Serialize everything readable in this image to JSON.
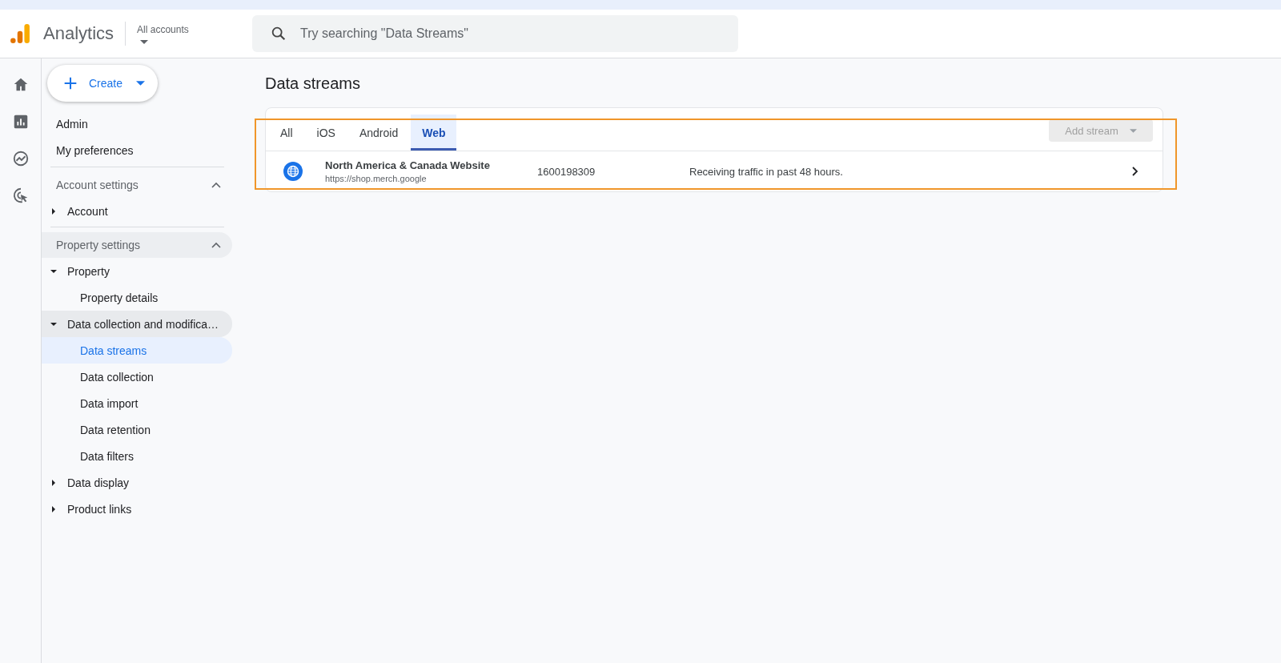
{
  "header": {
    "app_name": "Analytics",
    "account_label": "All accounts",
    "search": {
      "placeholder": "Try searching \"Data Streams\""
    }
  },
  "rail": [
    {
      "kind": "home",
      "selected": false
    },
    {
      "kind": "reports",
      "selected": false
    },
    {
      "kind": "explore",
      "selected": false
    },
    {
      "kind": "advertising",
      "selected": false
    }
  ],
  "create_button": "Create",
  "nav": [
    "Admin",
    "My preferences"
  ],
  "sections": [
    {
      "title": "Account settings",
      "expanded": true,
      "highlighted": false,
      "items": [
        {
          "label": "Account",
          "expanded": false,
          "highlighted": false
        }
      ]
    },
    {
      "title": "Property settings",
      "expanded": true,
      "highlighted": true,
      "items": [
        {
          "label": "Property",
          "expanded": true,
          "highlighted": false,
          "children": [
            {
              "label": "Property details",
              "selected": false
            }
          ]
        },
        {
          "label": "Data collection and modifica…",
          "expanded": true,
          "highlighted": true,
          "children": [
            {
              "label": "Data streams",
              "selected": true
            },
            {
              "label": "Data collection",
              "selected": false
            },
            {
              "label": "Data import",
              "selected": false
            },
            {
              "label": "Data retention",
              "selected": false
            },
            {
              "label": "Data filters",
              "selected": false
            }
          ]
        },
        {
          "label": "Data display",
          "expanded": false,
          "highlighted": false
        },
        {
          "label": "Product links",
          "expanded": false,
          "highlighted": false
        }
      ]
    }
  ],
  "page_title": "Data streams",
  "tabs": [
    {
      "label": "All",
      "selected": false
    },
    {
      "label": "iOS",
      "selected": false
    },
    {
      "label": "Android",
      "selected": false
    },
    {
      "label": "Web",
      "selected": true
    }
  ],
  "add_stream": {
    "label": "Add stream",
    "disabled": true
  },
  "streams": [
    {
      "name": "North America & Canada Website",
      "url": "https://shop.merch.google",
      "id": "1600198309",
      "status": "Receiving traffic in past 48 hours."
    }
  ],
  "highlight_frame": true
}
